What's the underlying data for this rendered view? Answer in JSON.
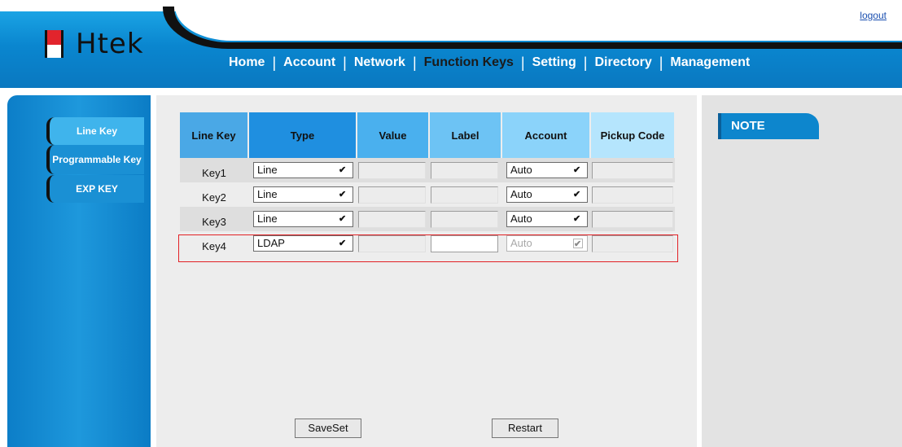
{
  "header": {
    "logo_text": "Htek",
    "logout": "logout",
    "nav": [
      "Home",
      "Account",
      "Network",
      "Function Keys",
      "Setting",
      "Directory",
      "Management"
    ],
    "active_nav": "Function Keys"
  },
  "sidebar": {
    "items": [
      {
        "label": "Line Key"
      },
      {
        "label": "Programmable Key"
      },
      {
        "label": "EXP KEY"
      }
    ]
  },
  "table": {
    "headers": [
      "Line Key",
      "Type",
      "Value",
      "Label",
      "Account",
      "Pickup Code"
    ],
    "rows": [
      {
        "key": "Key1",
        "type": "Line",
        "value": "",
        "label": "",
        "account": "Auto",
        "pickup": ""
      },
      {
        "key": "Key2",
        "type": "Line",
        "value": "",
        "label": "",
        "account": "Auto",
        "pickup": ""
      },
      {
        "key": "Key3",
        "type": "Line",
        "value": "",
        "label": "",
        "account": "Auto",
        "pickup": ""
      },
      {
        "key": "Key4",
        "type": "LDAP",
        "value": "",
        "label": "",
        "account": "Auto",
        "pickup": ""
      }
    ]
  },
  "buttons": {
    "save": "SaveSet",
    "restart": "Restart"
  },
  "note": {
    "title": "NOTE"
  },
  "colors": {
    "header_blue": "#0a86cf",
    "highlight": "#e22025"
  }
}
